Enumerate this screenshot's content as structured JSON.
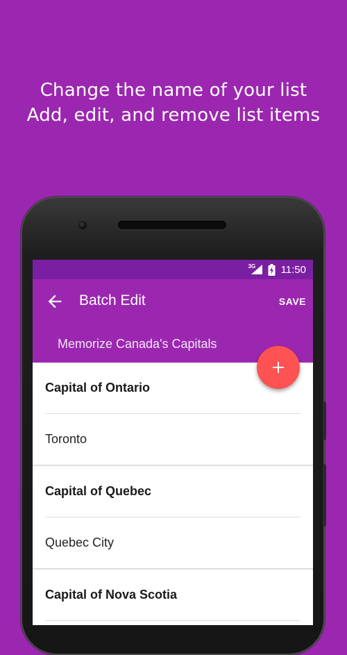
{
  "promo": {
    "line1": "Change the name of your list",
    "line2": "Add, edit, and remove list items"
  },
  "status_bar": {
    "network": "3G",
    "time": "11:50"
  },
  "app_bar": {
    "title": "Batch Edit",
    "save_label": "SAVE",
    "list_name": "Memorize Canada's Capitals"
  },
  "items": [
    {
      "question": "Capital of Ontario",
      "answer": "Toronto"
    },
    {
      "question": "Capital of Quebec",
      "answer": "Quebec City"
    },
    {
      "question": "Capital of Nova Scotia",
      "answer": ""
    }
  ],
  "colors": {
    "background": "#9b27b0",
    "status_bar": "#7b1fa2",
    "fab": "#ff5252"
  },
  "icons": {
    "back": "arrow-left-icon",
    "fab": "plus-icon",
    "signal": "signal-icon",
    "battery": "battery-charging-icon"
  }
}
